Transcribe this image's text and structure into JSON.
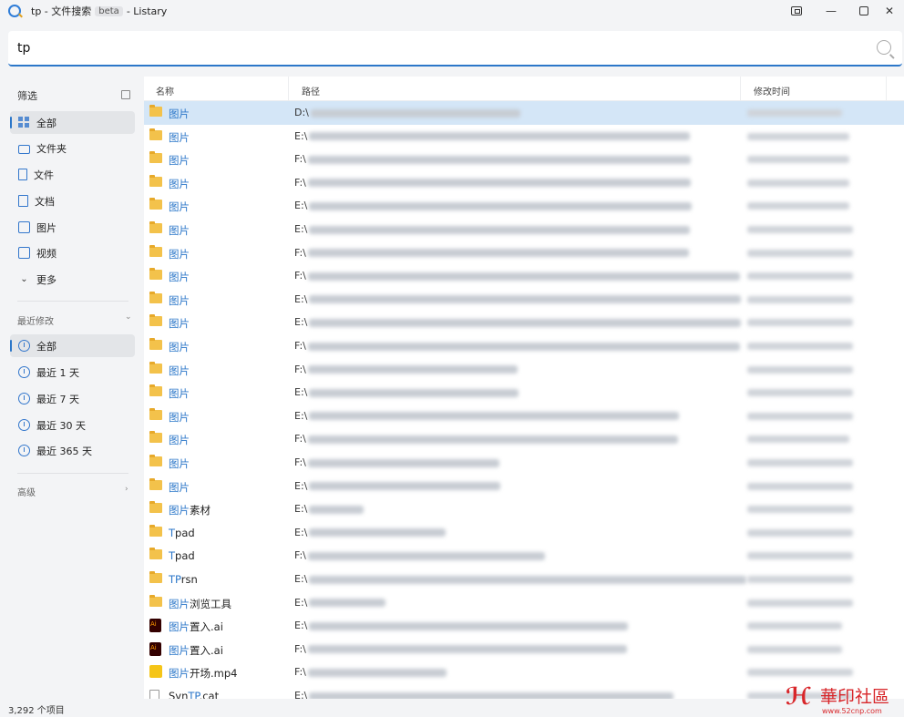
{
  "window": {
    "title_prefix": "tp - 文件搜索",
    "beta_badge": "beta",
    "title_suffix": "- Listary"
  },
  "search": {
    "value": "tp"
  },
  "sidebar": {
    "filter_header": "筛选",
    "filters": [
      {
        "label": "全部",
        "icon": "grid-icon"
      },
      {
        "label": "文件夹",
        "icon": "folder-icon"
      },
      {
        "label": "文件",
        "icon": "file-icon"
      },
      {
        "label": "文档",
        "icon": "document-icon"
      },
      {
        "label": "图片",
        "icon": "image-icon"
      },
      {
        "label": "视频",
        "icon": "video-icon"
      },
      {
        "label": "更多",
        "icon": "chevron-down-icon"
      }
    ],
    "recent_header": "最近修改",
    "recent": [
      {
        "label": "全部"
      },
      {
        "label": "最近 1 天"
      },
      {
        "label": "最近 7 天"
      },
      {
        "label": "最近 30 天"
      },
      {
        "label": "最近 365 天"
      }
    ],
    "advanced_header": "高级"
  },
  "columns": {
    "name": "名称",
    "path": "路径",
    "modified": "修改时间"
  },
  "rows": [
    {
      "hl": "图片",
      "rest": "",
      "drive": "D:\\",
      "type": "folder"
    },
    {
      "hl": "图片",
      "rest": "",
      "drive": "E:\\",
      "type": "folder"
    },
    {
      "hl": "图片",
      "rest": "",
      "drive": "F:\\",
      "type": "folder"
    },
    {
      "hl": "图片",
      "rest": "",
      "drive": "F:\\",
      "type": "folder"
    },
    {
      "hl": "图片",
      "rest": "",
      "drive": "E:\\",
      "type": "folder"
    },
    {
      "hl": "图片",
      "rest": "",
      "drive": "E:\\",
      "type": "folder"
    },
    {
      "hl": "图片",
      "rest": "",
      "drive": "F:\\",
      "type": "folder"
    },
    {
      "hl": "图片",
      "rest": "",
      "drive": "F:\\",
      "type": "folder"
    },
    {
      "hl": "图片",
      "rest": "",
      "drive": "E:\\",
      "type": "folder"
    },
    {
      "hl": "图片",
      "rest": "",
      "drive": "E:\\",
      "type": "folder"
    },
    {
      "hl": "图片",
      "rest": "",
      "drive": "F:\\",
      "type": "folder"
    },
    {
      "hl": "图片",
      "rest": "",
      "drive": "F:\\",
      "type": "folder"
    },
    {
      "hl": "图片",
      "rest": "",
      "drive": "E:\\",
      "type": "folder"
    },
    {
      "hl": "图片",
      "rest": "",
      "drive": "E:\\",
      "type": "folder"
    },
    {
      "hl": "图片",
      "rest": "",
      "drive": "F:\\",
      "type": "folder"
    },
    {
      "hl": "图片",
      "rest": "",
      "drive": "F:\\",
      "type": "folder"
    },
    {
      "hl": "图片",
      "rest": "",
      "drive": "E:\\",
      "type": "folder"
    },
    {
      "hl": "图片",
      "rest": "素材",
      "drive": "E:\\",
      "type": "folder"
    },
    {
      "hl": "T",
      "rest": "pad",
      "drive": "E:\\",
      "type": "folder"
    },
    {
      "hl": "T",
      "rest": "pad",
      "drive": "F:\\",
      "type": "folder"
    },
    {
      "hl": "TP",
      "rest": "rsn",
      "drive": "E:\\",
      "type": "folder"
    },
    {
      "hl": "图片",
      "rest": "浏览工具",
      "drive": "E:\\",
      "type": "folder"
    },
    {
      "hl": "图片",
      "rest": "置入.ai",
      "drive": "E:\\",
      "type": "ai"
    },
    {
      "hl": "图片",
      "rest": "置入.ai",
      "drive": "F:\\",
      "type": "ai"
    },
    {
      "hl": "图片",
      "rest": "开场.mp4",
      "drive": "F:\\",
      "type": "mp4"
    },
    {
      "hl": "",
      "pre": "Syn",
      "hl2": "TP",
      "rest": ".cat",
      "drive": "E:\\",
      "type": "cat"
    }
  ],
  "status": {
    "count": "3,292 个项目"
  },
  "watermark": {
    "brand": "華印社區",
    "url": "www.52cnp.com"
  }
}
